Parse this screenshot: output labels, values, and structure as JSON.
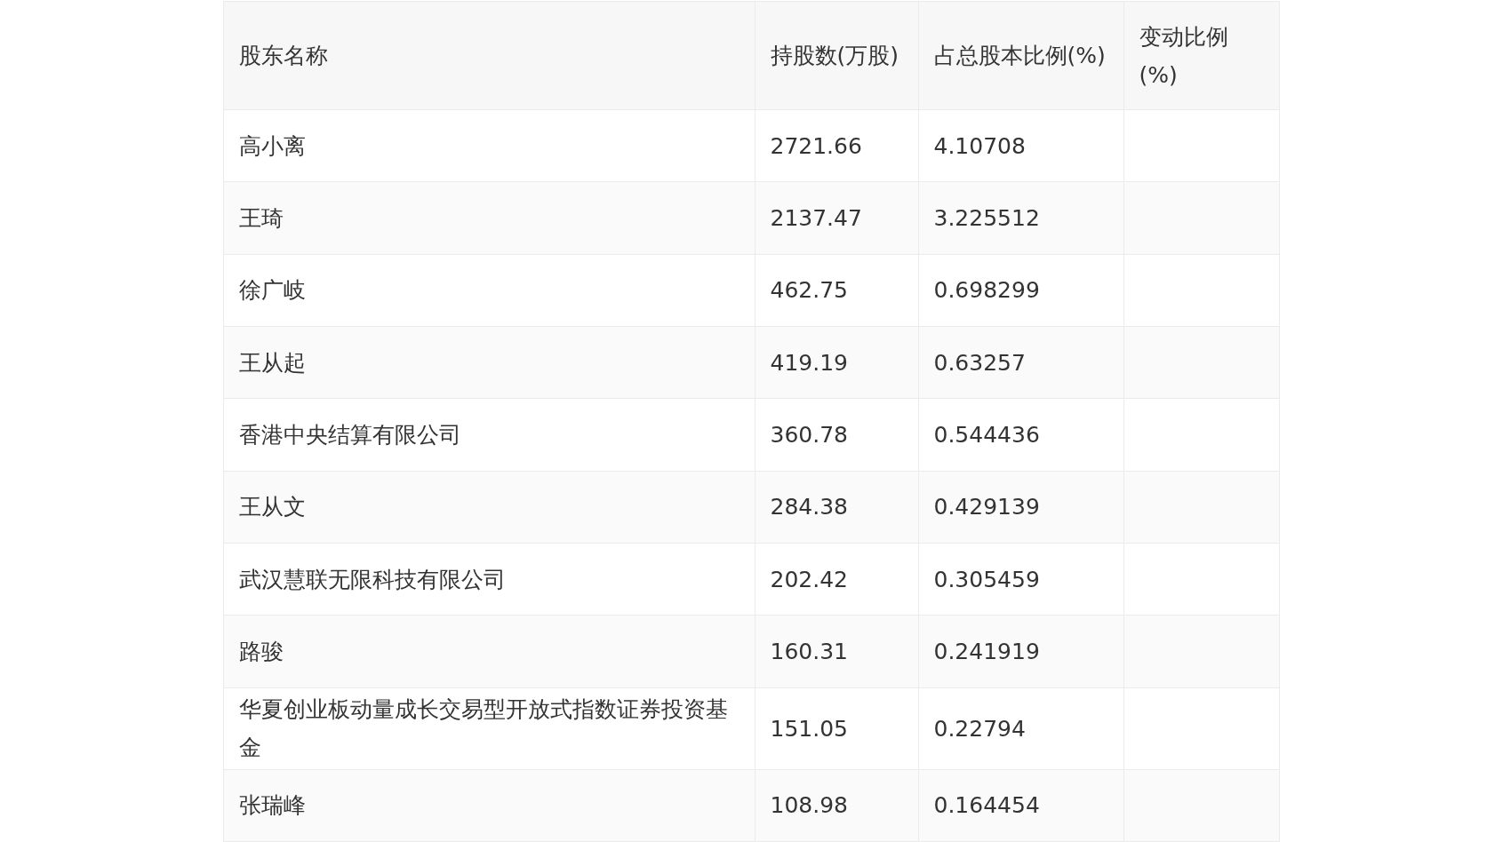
{
  "table": {
    "columns": [
      "股东名称",
      "持股数(万股)",
      "占总股本比例(%)",
      "变动比例(%)"
    ],
    "rows": [
      {
        "name": "高小离",
        "shares": "2721.66",
        "ratio": "4.10708"
      },
      {
        "name": "王琦",
        "shares": "2137.47",
        "ratio": "3.225512"
      },
      {
        "name": "徐广岐",
        "shares": "462.75",
        "ratio": "0.698299"
      },
      {
        "name": "王从起",
        "shares": "419.19",
        "ratio": "0.63257"
      },
      {
        "name": "香港中央结算有限公司",
        "shares": "360.78",
        "ratio": "0.544436"
      },
      {
        "name": "王从文",
        "shares": "284.38",
        "ratio": "0.429139"
      },
      {
        "name": "武汉慧联无限科技有限公司",
        "shares": "202.42",
        "ratio": "0.305459"
      },
      {
        "name": "路骏",
        "shares": "160.31",
        "ratio": "0.241919"
      },
      {
        "name": "华夏创业板动量成长交易型开放式指数证券投资基金",
        "shares": "151.05",
        "ratio": "0.22794"
      },
      {
        "name": "张瑞峰",
        "shares": "108.98",
        "ratio": "0.164454"
      }
    ]
  }
}
